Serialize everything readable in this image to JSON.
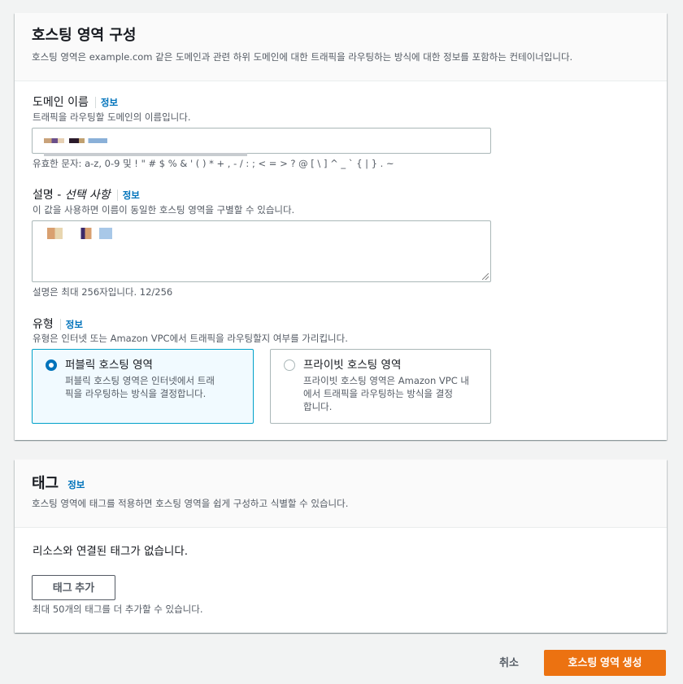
{
  "hosted_zone_config": {
    "title": "호스팅 영역 구성",
    "description": "호스팅 영역은 example.com 같은 도메인과 관련 하위 도메인에 대한 트래픽을 라우팅하는 방식에 대한 정보를 포함하는 컨테이너입니다.",
    "domain_name": {
      "label": "도메인 이름",
      "info": "정보",
      "hint": "트래픽을 라우팅할 도메인의 이름입니다.",
      "constraint": "유효한 문자: a-z, 0-9 및 ! \" # $ % & ' ( ) * + , - / : ; < = > ? @ [ \\ ] ^ _ ` { | } . ~"
    },
    "description_field": {
      "label_main": "설명 - ",
      "label_optional": "선택 사항",
      "info": "정보",
      "hint": "이 값을 사용하면 이름이 동일한 호스팅 영역을 구별할 수 있습니다.",
      "constraint": "설명은 최대 256자입니다. 12/256"
    },
    "type": {
      "label": "유형",
      "info": "정보",
      "hint": "유형은 인터넷 또는 Amazon VPC에서 트래픽을 라우팅할지 여부를 가리킵니다.",
      "options": [
        {
          "title": "퍼블릭 호스팅 영역",
          "desc_line1": "퍼블릭 호스팅 영역은 인터넷에서 트래",
          "desc_line2": "픽을 라우팅하는 방식을 결정합니다.",
          "desc_line3": "",
          "selected": true
        },
        {
          "title": "프라이빗 호스팅 영역",
          "desc_line1": "프라이빗 호스팅 영역은 Amazon VPC 내",
          "desc_line2": "에서 트래픽을 라우팅하는 방식을 결정",
          "desc_line3": "합니다.",
          "selected": false
        }
      ]
    }
  },
  "tags": {
    "title": "태그",
    "info": "정보",
    "description": "호스팅 영역에 태그를 적용하면 호스팅 영역을 쉽게 구성하고 식별할 수 있습니다.",
    "empty_text": "리소스와 연결된 태그가 없습니다.",
    "add_button": "태그 추가",
    "limit_hint": "최대 50개의 태그를 더 추가할 수 있습니다."
  },
  "footer": {
    "cancel": "취소",
    "create": "호스팅 영역 생성"
  },
  "colors": {
    "accent": "#ec7211",
    "link": "#0073bb",
    "selected_border": "#00a1c9"
  }
}
